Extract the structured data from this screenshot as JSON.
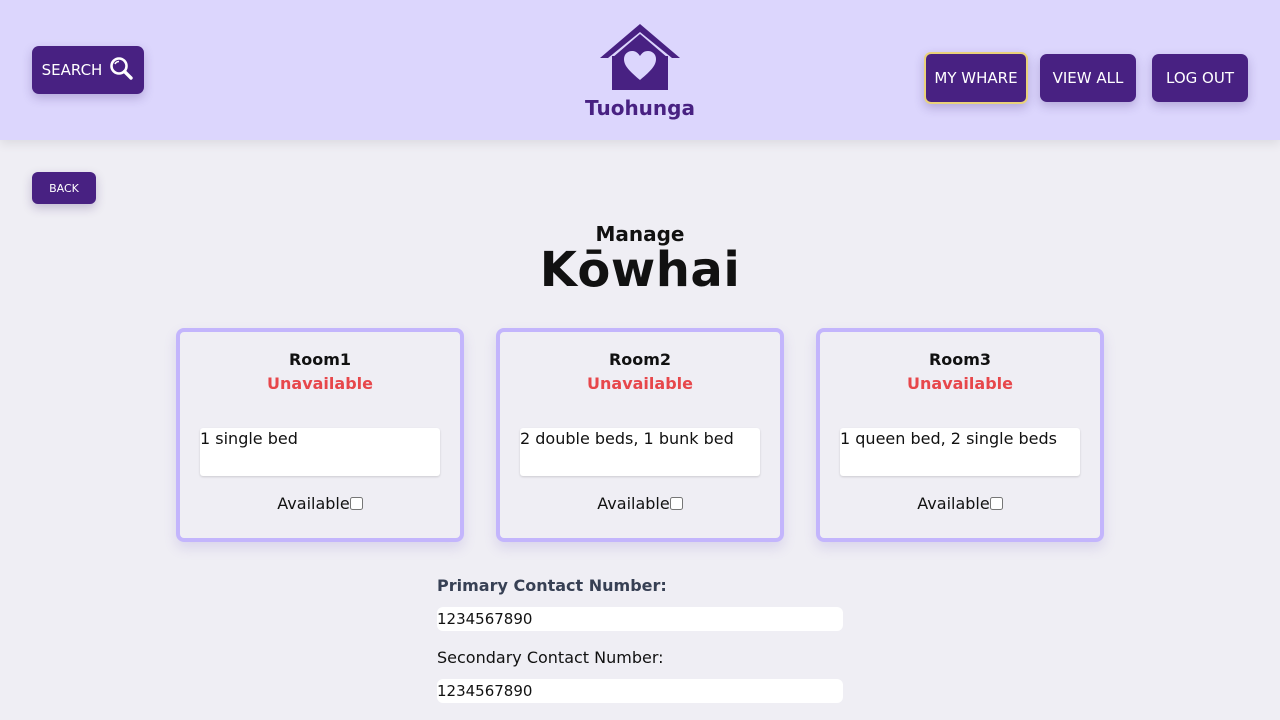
{
  "colors": {
    "header_bg": "#dcd6fd",
    "button_bg": "#482182",
    "accent_border": "#c3b5fc",
    "unavailable": "#e7474b",
    "page_bg": "#efeef4"
  },
  "header": {
    "search_label": "SEARCH",
    "search_icon": "magnifier-icon",
    "brand": "Tuohunga",
    "logo_icon": "house-heart-icon",
    "nav": {
      "my_whare": "MY WHARE",
      "view_all": "VIEW ALL",
      "log_out": "LOG OUT"
    }
  },
  "back_label": "BACK",
  "manage_label": "Manage",
  "whare_name": "Kōwhai",
  "rooms": [
    {
      "name": "Room1",
      "status": "Unavailable",
      "description": "1 single bed",
      "available_label": "Available",
      "available": false
    },
    {
      "name": "Room2",
      "status": "Unavailable",
      "description": "2 double beds, 1 bunk bed",
      "available_label": "Available",
      "available": false
    },
    {
      "name": "Room3",
      "status": "Unavailable",
      "description": "1 queen bed, 2 single beds",
      "available_label": "Available",
      "available": false
    }
  ],
  "contacts": {
    "primary_label": "Primary Contact Number:",
    "primary_value": "1234567890",
    "secondary_label": "Secondary Contact Number:",
    "secondary_value": "1234567890"
  }
}
